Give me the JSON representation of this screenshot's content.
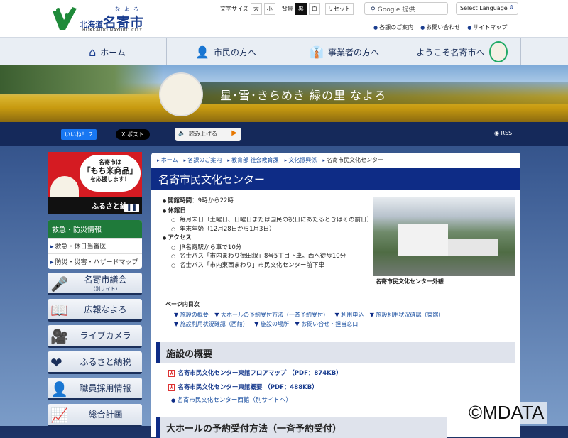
{
  "header": {
    "logo_ruby": "なよろ",
    "logo_pref": "北海道",
    "logo_city": "名寄市",
    "logo_en": "HOKKAIDO NAYORO CITY",
    "font_size_label": "文字サイズ",
    "font_large": "大",
    "font_small": "小",
    "bg_label": "背景",
    "bg_black": "黒",
    "bg_white": "白",
    "reset": "リセット",
    "search_placeholder": "Google 提供",
    "language": "Select Language",
    "links": [
      "各課のご案内",
      "お問い合わせ",
      "サイトマップ"
    ]
  },
  "nav": [
    "ホーム",
    "市民の方へ",
    "事業者の方へ",
    "ようこそ名寄市へ"
  ],
  "banner": {
    "slogan": "星･雪･きらめき 緑の里 なよろ"
  },
  "social": {
    "like": "いいね！ 2",
    "post": "X ポスト",
    "read_aloud": "読み上げる",
    "rss": "RSS"
  },
  "sidebar": {
    "ad": {
      "line1": "名寄市は",
      "line2": "「もち米商品」",
      "line3": "を応援します！",
      "bottom": "ふるさと納"
    },
    "emergency": {
      "title": "救急・防災情報",
      "items": [
        "救急・休日当番医",
        "防災・災害・ハザードマップ"
      ]
    },
    "buttons": [
      {
        "label": "名寄市議会",
        "sub": "(別サイト)"
      },
      {
        "label": "広報なよろ"
      },
      {
        "label": "ライブカメラ"
      },
      {
        "label": "ふるさと納税"
      },
      {
        "label": "職員採用情報"
      },
      {
        "label": "総合計画"
      }
    ]
  },
  "breadcrumb": [
    "ホーム",
    "各課のご案内",
    "教育部 社会教育課",
    "文化振興係",
    "名寄市民文化センター"
  ],
  "page_title": "名寄市民文化センター",
  "info": {
    "hours_label": "開館時間",
    "hours": "：9時から22時",
    "closed_label": "休館日",
    "closed": [
      "毎月末日（土曜日、日曜日または国民の祝日にあたるときはその前日）",
      "年末年始（12月28日から1月3日）"
    ],
    "access_label": "アクセス",
    "access": [
      "JR名寄駅から車で10分",
      "名士バス「市内まわり徳田線」8号5丁目下車。西へ徒歩10分",
      "名士バス「市内東西まわり」市民文化センター前下車"
    ]
  },
  "photo_caption": "名寄市民文化センター外観",
  "toc": {
    "title": "ページ内目次",
    "items": [
      "施設の概要",
      "大ホールの予約受付方法（一斉予約受付）",
      "利用申込",
      "施設利用状況確認（東館）",
      "施設利用状況確認（西館）",
      "施設の場所",
      "お問い合せ・担当窓口"
    ]
  },
  "section1": {
    "title": "施設の概要",
    "pdfs": [
      "名寄市民文化センター東館フロアマップ （PDF：874KB）",
      "名寄市民文化センター東館概要 （PDF：488KB）"
    ],
    "link": "名寄市民文化センター西館（別サイトへ）"
  },
  "section2": {
    "title": "大ホールの予約受付方法（一斉予約受付）"
  },
  "watermark": "©MDATA"
}
